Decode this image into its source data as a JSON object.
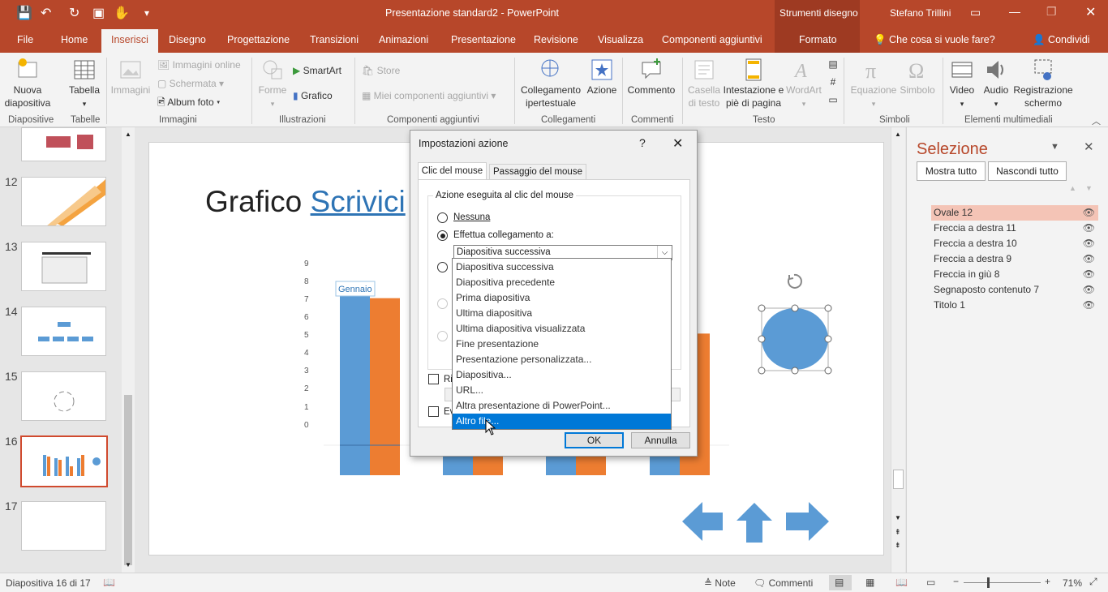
{
  "window": {
    "title": "Presentazione standard2 - PowerPoint",
    "context_tab": "Strumenti disegno",
    "user": "Stefano Trillini"
  },
  "tabs": [
    "File",
    "Home",
    "Inserisci",
    "Disegno",
    "Progettazione",
    "Transizioni",
    "Animazioni",
    "Presentazione",
    "Revisione",
    "Visualizza",
    "Componenti aggiuntivi",
    "Formato"
  ],
  "tell_me": "Che cosa si vuole fare?",
  "share": "Condividi",
  "ribbon": {
    "new_slide": "Nuova diapositiva",
    "table": "Tabella",
    "images": "Immagini",
    "online_images": "Immagini online",
    "screenshot": "Schermata",
    "photo_album": "Album foto",
    "shapes": "Forme",
    "smartart": "SmartArt",
    "chart": "Grafico",
    "store": "Store",
    "my_addins": "Miei componenti aggiuntivi",
    "hyperlink": "Collegamento ipertestuale",
    "action": "Azione",
    "comment": "Commento",
    "textbox": "Casella di testo",
    "header_footer": "Intestazione e piè di pagina",
    "wordart": "WordArt",
    "equation": "Equazione",
    "symbol": "Simbolo",
    "video": "Video",
    "audio": "Audio",
    "screen_recording": "Registrazione schermo",
    "groups": {
      "slides": "Diapositive",
      "tables": "Tabelle",
      "images": "Immagini",
      "illustrations": "Illustrazioni",
      "addins": "Componenti aggiuntivi",
      "links": "Collegamenti",
      "comments": "Commenti",
      "text": "Testo",
      "symbols": "Simboli",
      "media": "Elementi multimediali"
    }
  },
  "thumbnails": [
    {
      "num": ""
    },
    {
      "num": "12"
    },
    {
      "num": "13"
    },
    {
      "num": "14"
    },
    {
      "num": "15"
    },
    {
      "num": "16"
    },
    {
      "num": "17"
    }
  ],
  "slide": {
    "title_plain": "Grafico ",
    "title_link": "Scrivici",
    "y_ticks": [
      "9",
      "8",
      "7",
      "6",
      "5",
      "4",
      "3",
      "2",
      "1",
      "0"
    ],
    "bar_label": "Gennaio"
  },
  "chart_data": {
    "type": "bar",
    "categories": [
      "Gennaio",
      "",
      "",
      ""
    ],
    "series": [
      {
        "values": [
          7.9,
          0,
          0,
          0
        ]
      },
      {
        "values": [
          7.5,
          0,
          0,
          6.0
        ]
      }
    ],
    "ylim": [
      0,
      9
    ]
  },
  "dialog": {
    "title": "Impostazioni azione",
    "help": "?",
    "tab1": "Clic del mouse",
    "tab2": "Passaggio del mouse",
    "group_label": "Azione eseguita al clic del mouse",
    "opt_none": "Nessuna",
    "opt_link": "Effettua collegamento a:",
    "combo_value": "Diapositiva successiva",
    "check1": "Ri",
    "check2": "Ev",
    "ok": "OK",
    "cancel": "Annulla",
    "options": [
      "Diapositiva successiva",
      "Diapositiva precedente",
      "Prima diapositiva",
      "Ultima diapositiva",
      "Ultima diapositiva visualizzata",
      "Fine presentazione",
      "Presentazione personalizzata...",
      "Diapositiva...",
      "URL...",
      "Altra presentazione di PowerPoint...",
      "Altro file..."
    ],
    "hovered": "Altro file..."
  },
  "selection_pane": {
    "title": "Selezione",
    "show_all": "Mostra tutto",
    "hide_all": "Nascondi tutto",
    "items": [
      "Ovale 12",
      "Freccia a destra 11",
      "Freccia a destra 10",
      "Freccia a destra 9",
      "Freccia in giù 8",
      "Segnaposto contenuto 7",
      "Titolo 1"
    ]
  },
  "status": {
    "slide_info": "Diapositiva 16 di 17",
    "notes": "Note",
    "comments": "Commenti",
    "zoom": "71%"
  },
  "colors": {
    "accent": "#b7472a",
    "bar_blue": "#5b9bd5",
    "bar_orange": "#ed7d31",
    "highlight": "#0078d7"
  }
}
